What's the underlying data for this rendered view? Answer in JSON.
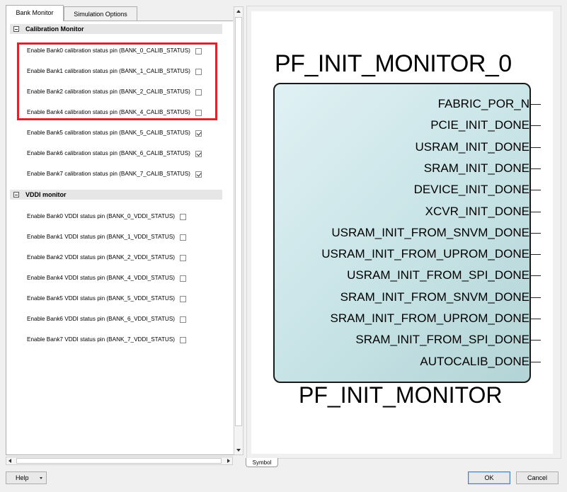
{
  "tabs": [
    {
      "label": "Bank Monitor",
      "active": true
    },
    {
      "label": "Simulation Options",
      "active": false
    }
  ],
  "calibration": {
    "title": "Calibration Monitor",
    "options": [
      {
        "label": "Enable Bank0 calibration status pin (BANK_0_CALIB_STATUS)",
        "checked": false
      },
      {
        "label": "Enable Bank1 calibration status pin (BANK_1_CALIB_STATUS)",
        "checked": false
      },
      {
        "label": "Enable Bank2 calibration status pin (BANK_2_CALIB_STATUS)",
        "checked": false
      },
      {
        "label": "Enable Bank4 calibration status pin (BANK_4_CALIB_STATUS)",
        "checked": false
      },
      {
        "label": "Enable Bank5 calibration status pin (BANK_5_CALIB_STATUS)",
        "checked": true
      },
      {
        "label": "Enable Bank6 calibration status pin (BANK_6_CALIB_STATUS)",
        "checked": true
      },
      {
        "label": "Enable Bank7 calibration status pin (BANK_7_CALIB_STATUS)",
        "checked": true
      }
    ]
  },
  "vddi": {
    "title": "VDDI monitor",
    "options": [
      {
        "label": "Enable Bank0 VDDI status pin (BANK_0_VDDI_STATUS)",
        "checked": false
      },
      {
        "label": "Enable Bank1 VDDI status pin (BANK_1_VDDI_STATUS)",
        "checked": false
      },
      {
        "label": "Enable Bank2 VDDI status pin (BANK_2_VDDI_STATUS)",
        "checked": false
      },
      {
        "label": "Enable Bank4 VDDI status pin (BANK_4_VDDI_STATUS)",
        "checked": false
      },
      {
        "label": "Enable Bank5 VDDI status pin (BANK_5_VDDI_STATUS)",
        "checked": false
      },
      {
        "label": "Enable Bank6 VDDI status pin (BANK_6_VDDI_STATUS)",
        "checked": false
      },
      {
        "label": "Enable Bank7 VDDI status pin (BANK_7_VDDI_STATUS)",
        "checked": false
      }
    ]
  },
  "symbol": {
    "instance_name": "PF_INIT_MONITOR_0",
    "component_name": "PF_INIT_MONITOR",
    "ports": [
      "FABRIC_POR_N",
      "PCIE_INIT_DONE",
      "USRAM_INIT_DONE",
      "SRAM_INIT_DONE",
      "DEVICE_INIT_DONE",
      "XCVR_INIT_DONE",
      "USRAM_INIT_FROM_SNVM_DONE",
      "USRAM_INIT_FROM_UPROM_DONE",
      "USRAM_INIT_FROM_SPI_DONE",
      "SRAM_INIT_FROM_SNVM_DONE",
      "SRAM_INIT_FROM_UPROM_DONE",
      "SRAM_INIT_FROM_SPI_DONE",
      "AUTOCALIB_DONE"
    ],
    "tab_label": "Symbol"
  },
  "buttons": {
    "help": "Help",
    "ok": "OK",
    "cancel": "Cancel"
  },
  "colors": {
    "highlight": "#d9262e",
    "block_fill": "#c7e3e6"
  }
}
